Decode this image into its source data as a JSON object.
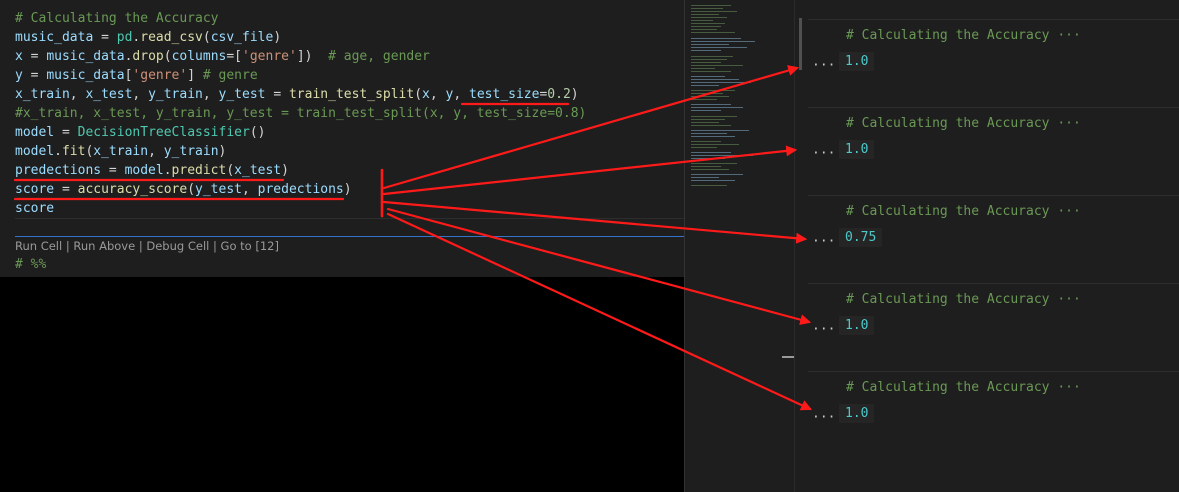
{
  "editor": {
    "lines": [
      {
        "segments": [
          {
            "t": "# Calculating the Accuracy",
            "c": "comment"
          }
        ]
      },
      {
        "segments": [
          {
            "t": "music_data",
            "c": "var"
          },
          {
            "t": " = ",
            "c": "op"
          },
          {
            "t": "pd",
            "c": "cls"
          },
          {
            "t": ".",
            "c": "op"
          },
          {
            "t": "read_csv",
            "c": "fn"
          },
          {
            "t": "(",
            "c": "op"
          },
          {
            "t": "csv_file",
            "c": "var"
          },
          {
            "t": ")",
            "c": "op"
          }
        ]
      },
      {
        "segments": [
          {
            "t": "x",
            "c": "var"
          },
          {
            "t": " = ",
            "c": "op"
          },
          {
            "t": "music_data",
            "c": "var"
          },
          {
            "t": ".",
            "c": "op"
          },
          {
            "t": "drop",
            "c": "fn"
          },
          {
            "t": "(",
            "c": "op"
          },
          {
            "t": "columns",
            "c": "var"
          },
          {
            "t": "=[",
            "c": "op"
          },
          {
            "t": "'genre'",
            "c": "str"
          },
          {
            "t": "])  ",
            "c": "op"
          },
          {
            "t": "# age, gender",
            "c": "comment"
          }
        ]
      },
      {
        "segments": [
          {
            "t": "y",
            "c": "var"
          },
          {
            "t": " = ",
            "c": "op"
          },
          {
            "t": "music_data",
            "c": "var"
          },
          {
            "t": "[",
            "c": "op"
          },
          {
            "t": "'genre'",
            "c": "str"
          },
          {
            "t": "] ",
            "c": "op"
          },
          {
            "t": "# genre",
            "c": "comment"
          }
        ]
      },
      {
        "segments": [
          {
            "t": "x_train",
            "c": "var"
          },
          {
            "t": ", ",
            "c": "op"
          },
          {
            "t": "x_test",
            "c": "var"
          },
          {
            "t": ", ",
            "c": "op"
          },
          {
            "t": "y_train",
            "c": "var"
          },
          {
            "t": ", ",
            "c": "op"
          },
          {
            "t": "y_test",
            "c": "var"
          },
          {
            "t": " = ",
            "c": "op"
          },
          {
            "t": "train_test_split",
            "c": "fn"
          },
          {
            "t": "(",
            "c": "op"
          },
          {
            "t": "x",
            "c": "var"
          },
          {
            "t": ", ",
            "c": "op"
          },
          {
            "t": "y",
            "c": "var"
          },
          {
            "t": ", ",
            "c": "op"
          },
          {
            "t": "test_size",
            "c": "var"
          },
          {
            "t": "=",
            "c": "op"
          },
          {
            "t": "0.2",
            "c": "num"
          },
          {
            "t": ")",
            "c": "op"
          }
        ]
      },
      {
        "segments": [
          {
            "t": "#x_train, x_test, y_train, y_test = train_test_split(x, y, test_size=0.8)",
            "c": "comment"
          }
        ]
      },
      {
        "segments": [
          {
            "t": "model",
            "c": "var"
          },
          {
            "t": " = ",
            "c": "op"
          },
          {
            "t": "DecisionTreeClassifier",
            "c": "cls"
          },
          {
            "t": "()",
            "c": "op"
          }
        ]
      },
      {
        "segments": [
          {
            "t": "model",
            "c": "var"
          },
          {
            "t": ".",
            "c": "op"
          },
          {
            "t": "fit",
            "c": "fn"
          },
          {
            "t": "(",
            "c": "op"
          },
          {
            "t": "x_train",
            "c": "var"
          },
          {
            "t": ", ",
            "c": "op"
          },
          {
            "t": "y_train",
            "c": "var"
          },
          {
            "t": ")",
            "c": "op"
          }
        ]
      },
      {
        "segments": [
          {
            "t": "predections",
            "c": "var"
          },
          {
            "t": " = ",
            "c": "op"
          },
          {
            "t": "model",
            "c": "var"
          },
          {
            "t": ".",
            "c": "op"
          },
          {
            "t": "predict",
            "c": "fn"
          },
          {
            "t": "(",
            "c": "op"
          },
          {
            "t": "x_test",
            "c": "var"
          },
          {
            "t": ")",
            "c": "op"
          }
        ]
      },
      {
        "segments": [
          {
            "t": "score",
            "c": "var"
          },
          {
            "t": " = ",
            "c": "op"
          },
          {
            "t": "accuracy_score",
            "c": "fn"
          },
          {
            "t": "(",
            "c": "op"
          },
          {
            "t": "y_test",
            "c": "var"
          },
          {
            "t": ", ",
            "c": "op"
          },
          {
            "t": "predections",
            "c": "var"
          },
          {
            "t": ")",
            "c": "op"
          }
        ]
      },
      {
        "segments": [
          {
            "t": "score",
            "c": "var"
          }
        ]
      }
    ],
    "codelens": {
      "run_cell": "Run Cell",
      "run_above": "Run Above",
      "debug_cell": "Debug Cell",
      "go_to": "Go to [12]",
      "separator": " | "
    },
    "next_cell_marker": "# %%"
  },
  "outputs": [
    {
      "header": "# Calculating the Accuracy ···",
      "value": "1.0"
    },
    {
      "header": "# Calculating the Accuracy ···",
      "value": "1.0"
    },
    {
      "header": "# Calculating the Accuracy ···",
      "value": "0.75"
    },
    {
      "header": "# Calculating the Accuracy ···",
      "value": "1.0"
    },
    {
      "header": "# Calculating the Accuracy ···",
      "value": "1.0"
    }
  ],
  "output_more_label": "···",
  "colors": {
    "annotation_red": "#ff1a1a",
    "comment": "#6a9955",
    "output_value": "#4ec9c9",
    "cell_separator": "#3573c9"
  }
}
